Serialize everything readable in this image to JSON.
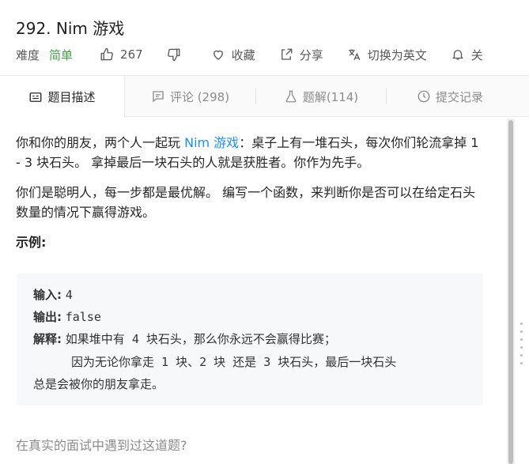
{
  "problem": {
    "title": "292. Nim 游戏",
    "difficulty_label": "难度",
    "difficulty": "简单",
    "likes": "267",
    "favorite_label": "收藏",
    "share_label": "分享",
    "switch_lang_label": "切换为英文",
    "follow_label": "关"
  },
  "tabs": [
    {
      "label": "题目描述",
      "icon": "description-icon"
    },
    {
      "label": "评论 (298)",
      "icon": "comment-icon"
    },
    {
      "label": "题解(114)",
      "icon": "flask-icon"
    },
    {
      "label": "提交记录",
      "icon": "clock-icon"
    }
  ],
  "description": {
    "p1_before": "你和你的朋友，两个人一起玩 ",
    "p1_link": "Nim 游戏",
    "p1_after": "：桌子上有一堆石头，每次你们轮流拿掉 1 - 3 块石头。 拿掉最后一块石头的人就是获胜者。你作为先手。",
    "p2": "你们是聪明人，每一步都是最优解。 编写一个函数，来判断你是否可以在给定石头数量的情况下赢得游戏。",
    "example_heading": "示例:"
  },
  "example": {
    "input_label": "输入:",
    "input_value": "4",
    "output_label": "输出:",
    "output_value": "false",
    "explain_label": "解释:",
    "explain_line1": "如果堆中有 4 块石头，那么你永远不会赢得比赛；",
    "explain_line2": "因为无论你拿走 1 块、2 块 还是 3 块石头，最后一块石头",
    "explain_line3": "总是会被你的朋友拿走。"
  },
  "footer_question": "在真实的面试中遇到过这道题?",
  "colors": {
    "easy": "#43a047",
    "link": "#1a90ff",
    "muted": "#8c8c8c"
  }
}
